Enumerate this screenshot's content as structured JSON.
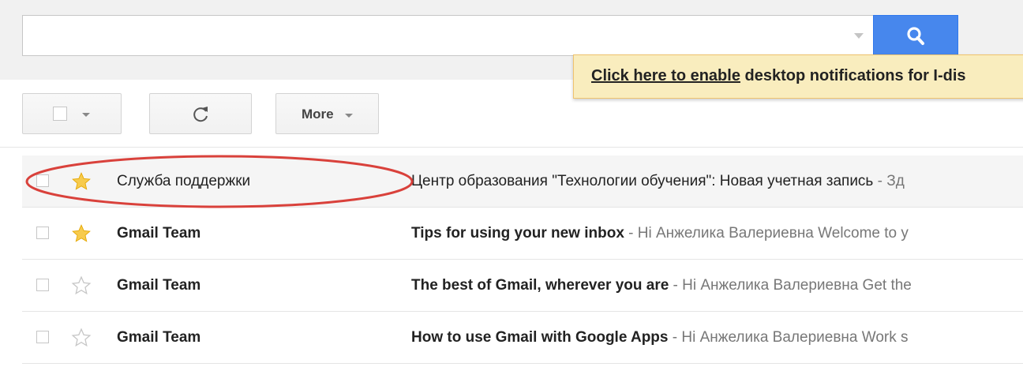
{
  "search": {
    "value": "",
    "placeholder": ""
  },
  "notification": {
    "link_text": "Click here to enable",
    "rest_text": " desktop notifications for I-dis"
  },
  "toolbar": {
    "more_label": "More"
  },
  "emails": [
    {
      "sender": "Служба поддержки",
      "subject": "Центр образования \"Технологии обучения\": Новая учетная запись",
      "snippet": " - Зд",
      "starred": true,
      "unread": false
    },
    {
      "sender": "Gmail Team",
      "subject": "Tips for using your new inbox",
      "snippet": " - Hi Анжелика Валериевна Welcome to y",
      "starred": true,
      "unread": true
    },
    {
      "sender": "Gmail Team",
      "subject": "The best of Gmail, wherever you are",
      "snippet": " - Hi Анжелика Валериевна Get the",
      "starred": false,
      "unread": true
    },
    {
      "sender": "Gmail Team",
      "subject": "How to use Gmail with Google Apps",
      "snippet": " - Hi Анжелика Валериевна Work s",
      "starred": false,
      "unread": true
    }
  ],
  "colors": {
    "search_button": "#4787ed",
    "star_filled": "#f7cb4d",
    "annotation": "#d9413b",
    "notification_bg": "#f9edbe"
  }
}
